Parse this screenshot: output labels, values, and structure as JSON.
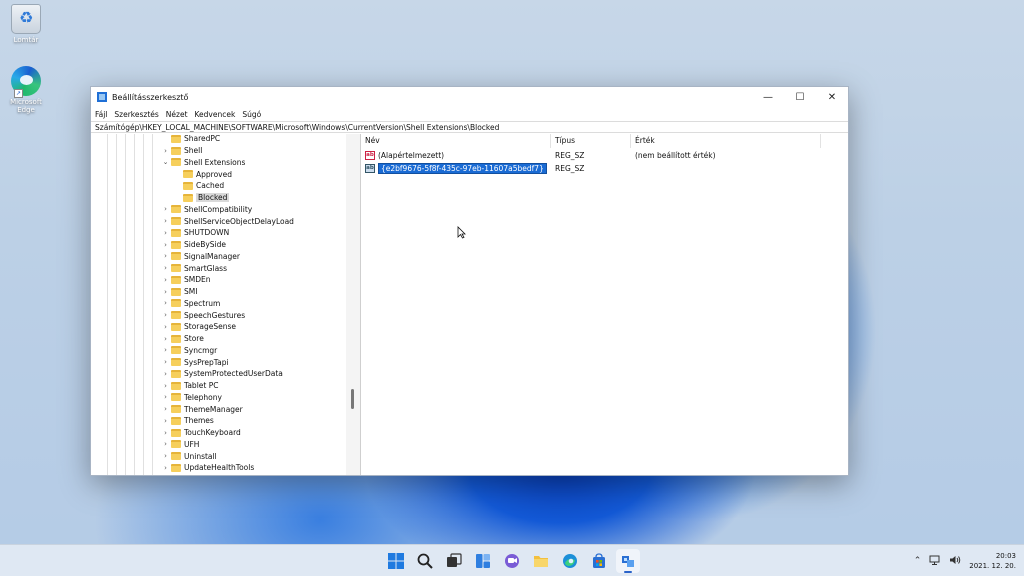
{
  "desktop": {
    "icons": [
      {
        "label": "Lomtár"
      },
      {
        "label": "Microsoft Edge"
      }
    ]
  },
  "window": {
    "title": "Beállításszerkesztő",
    "controls": {
      "minimize": "—",
      "maximize": "☐",
      "close": "✕"
    },
    "menu": [
      "Fájl",
      "Szerkesztés",
      "Nézet",
      "Kedvencek",
      "Súgó"
    ],
    "address": "Számítógép\\HKEY_LOCAL_MACHINE\\SOFTWARE\\Microsoft\\Windows\\CurrentVersion\\Shell Extensions\\Blocked",
    "tree": [
      {
        "label": "SharedPC",
        "chev": ""
      },
      {
        "label": "Shell",
        "chev": "›"
      },
      {
        "label": "Shell Extensions",
        "chev": "⌄"
      },
      {
        "label": "Approved",
        "chev": ""
      },
      {
        "label": "Cached",
        "chev": ""
      },
      {
        "label": "Blocked",
        "chev": ""
      },
      {
        "label": "ShellCompatibility",
        "chev": "›"
      },
      {
        "label": "ShellServiceObjectDelayLoad",
        "chev": "›"
      },
      {
        "label": "SHUTDOWN",
        "chev": "›"
      },
      {
        "label": "SideBySide",
        "chev": "›"
      },
      {
        "label": "SignalManager",
        "chev": "›"
      },
      {
        "label": "SmartGlass",
        "chev": "›"
      },
      {
        "label": "SMDEn",
        "chev": "›"
      },
      {
        "label": "SMI",
        "chev": "›"
      },
      {
        "label": "Spectrum",
        "chev": "›"
      },
      {
        "label": "SpeechGestures",
        "chev": "›"
      },
      {
        "label": "StorageSense",
        "chev": "›"
      },
      {
        "label": "Store",
        "chev": "›"
      },
      {
        "label": "Syncmgr",
        "chev": "›"
      },
      {
        "label": "SysPrepTapi",
        "chev": "›"
      },
      {
        "label": "SystemProtectedUserData",
        "chev": "›"
      },
      {
        "label": "Tablet PC",
        "chev": "›"
      },
      {
        "label": "Telephony",
        "chev": "›"
      },
      {
        "label": "ThemeManager",
        "chev": "›"
      },
      {
        "label": "Themes",
        "chev": "›"
      },
      {
        "label": "TouchKeyboard",
        "chev": "›"
      },
      {
        "label": "UFH",
        "chev": "›"
      },
      {
        "label": "Uninstall",
        "chev": "›"
      },
      {
        "label": "UpdateHealthTools",
        "chev": "›"
      }
    ],
    "columns": [
      "Név",
      "Típus",
      "Érték"
    ],
    "values": [
      {
        "name": "(Alapértelmezett)",
        "type": "REG_SZ",
        "data": "(nem beállított érték)"
      },
      {
        "name": "{e2bf9676-5f8f-435c-97eb-11607a5bedf7}",
        "type": "REG_SZ",
        "data": ""
      }
    ]
  },
  "taskbar": {
    "icons": [
      "windows-start-icon",
      "search-icon",
      "task-view-icon",
      "widgets-icon",
      "chat-icon",
      "file-explorer-icon",
      "edge-icon",
      "store-icon",
      "regedit-icon"
    ],
    "time": "20:03",
    "date": "2021. 12. 20."
  }
}
